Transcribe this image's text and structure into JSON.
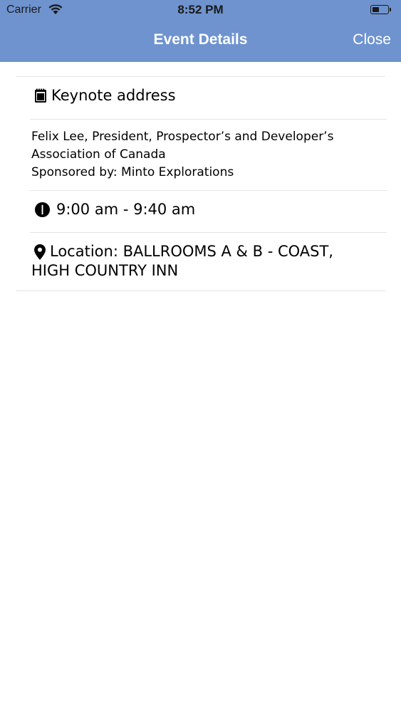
{
  "status_bar": {
    "carrier": "Carrier",
    "time": "8:52 PM",
    "battery_level": 0.45
  },
  "nav": {
    "title": "Event Details",
    "close_label": "Close",
    "background_color": "#6e93cf"
  },
  "event": {
    "title": "Keynote address",
    "title_icon": "notepad-icon",
    "description_lines": [
      "Felix Lee, President, Prospector’s and Developer’s",
      "Association of Canada",
      "Sponsored by: Minto Explorations"
    ],
    "time": "9:00 am - 9:40 am",
    "time_icon": "clock-icon",
    "location_lines": [
      "Location: BALLROOMS A & B - COAST,",
      "HIGH COUNTRY INN"
    ],
    "location_icon": "map-pin-icon"
  }
}
